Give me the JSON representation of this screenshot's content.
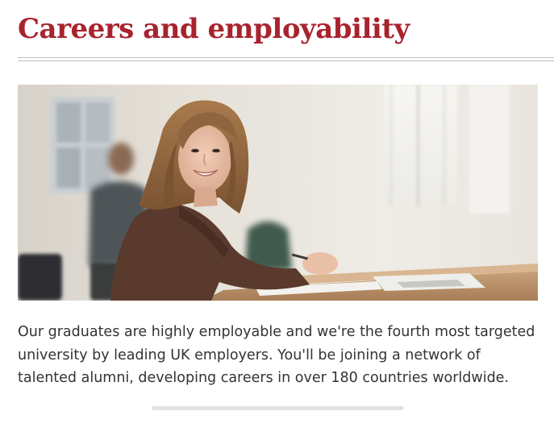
{
  "section": {
    "title": "Careers and employability",
    "intro": "Our graduates are highly employable and we're the fourth most targeted university by leading UK employers. You'll be joining a network of talented alumni, developing careers in over 180 countries worldwide."
  },
  "colors": {
    "heading": "#a8232d",
    "body_text": "#333333",
    "rule": "#bfbfbf"
  }
}
